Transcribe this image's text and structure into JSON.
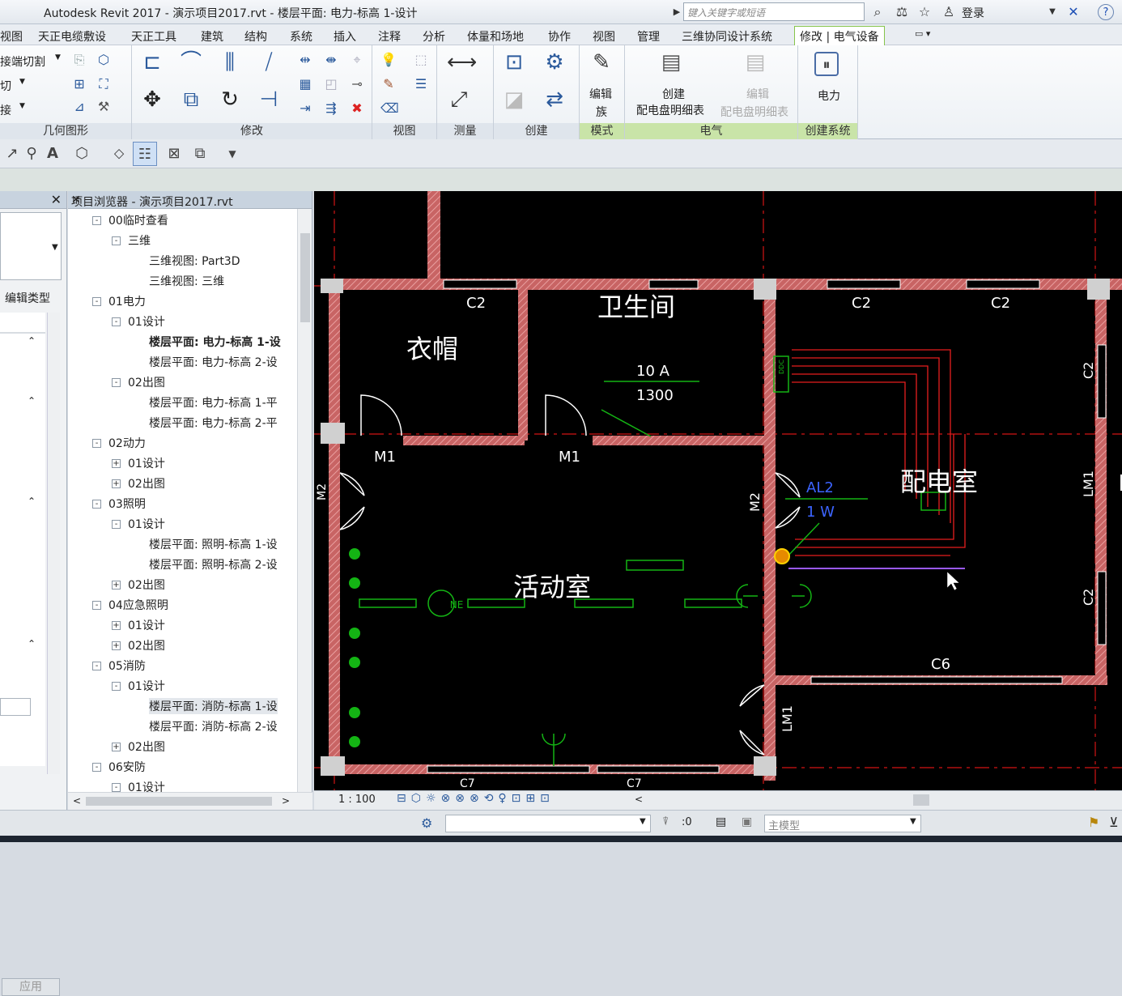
{
  "title": "Autodesk Revit 2017 -      演示项目2017.rvt - 楼层平面: 电力-标高 1-设计",
  "search_placeholder": "键入关键字或短语",
  "login": "登录",
  "menu": [
    "视图",
    "天正电缆敷设",
    "天正工具",
    "建筑",
    "结构",
    "系统",
    "插入",
    "注释",
    "分析",
    "体量和场地",
    "协作",
    "视图",
    "管理",
    "三维协同设计系统",
    "修改 | 电气设备"
  ],
  "ribbon": {
    "geom_items": [
      "接端切割",
      "切",
      "接"
    ],
    "panels": [
      "几何图形",
      "修改",
      "视图",
      "测量",
      "创建",
      "模式",
      "电气",
      "创建系统"
    ],
    "edit_family": [
      "编辑",
      "族"
    ],
    "create_schedule": [
      "创建",
      "配电盘明细表"
    ],
    "edit_schedule": [
      "编辑",
      "配电盘明细表"
    ],
    "power": "电力"
  },
  "props": {
    "edit_type": "编辑类型",
    "apply": "应用"
  },
  "browser": {
    "title": "项目浏览器 - 演示项目2017.rvt",
    "items": [
      {
        "t": "00临时查看",
        "lv": 0,
        "ex": "-"
      },
      {
        "t": "三维",
        "lv": 1,
        "ex": "-"
      },
      {
        "t": "三维视图: Part3D",
        "lv": 2
      },
      {
        "t": "三维视图: 三维",
        "lv": 2
      },
      {
        "t": "01电力",
        "lv": 0,
        "ex": "-"
      },
      {
        "t": "01设计",
        "lv": 1,
        "ex": "-"
      },
      {
        "t": "楼层平面: 电力-标高 1-设",
        "lv": 2,
        "bold": true
      },
      {
        "t": "楼层平面: 电力-标高 2-设",
        "lv": 2
      },
      {
        "t": "02出图",
        "lv": 1,
        "ex": "-"
      },
      {
        "t": "楼层平面: 电力-标高 1-平",
        "lv": 2
      },
      {
        "t": "楼层平面: 电力-标高 2-平",
        "lv": 2
      },
      {
        "t": "02动力",
        "lv": 0,
        "ex": "-"
      },
      {
        "t": "01设计",
        "lv": 1,
        "ex": "+"
      },
      {
        "t": "02出图",
        "lv": 1,
        "ex": "+"
      },
      {
        "t": "03照明",
        "lv": 0,
        "ex": "-"
      },
      {
        "t": "01设计",
        "lv": 1,
        "ex": "-"
      },
      {
        "t": "楼层平面: 照明-标高 1-设",
        "lv": 2
      },
      {
        "t": "楼层平面: 照明-标高 2-设",
        "lv": 2
      },
      {
        "t": "02出图",
        "lv": 1,
        "ex": "+"
      },
      {
        "t": "04应急照明",
        "lv": 0,
        "ex": "-"
      },
      {
        "t": "01设计",
        "lv": 1,
        "ex": "+"
      },
      {
        "t": "02出图",
        "lv": 1,
        "ex": "+"
      },
      {
        "t": "05消防",
        "lv": 0,
        "ex": "-"
      },
      {
        "t": "01设计",
        "lv": 1,
        "ex": "-"
      },
      {
        "t": "楼层平面: 消防-标高 1-设",
        "lv": 2,
        "sel": true
      },
      {
        "t": "楼层平面: 消防-标高 2-设",
        "lv": 2
      },
      {
        "t": "02出图",
        "lv": 1,
        "ex": "+"
      },
      {
        "t": "06安防",
        "lv": 0,
        "ex": "-"
      },
      {
        "t": "01设计",
        "lv": 1,
        "ex": "-"
      }
    ]
  },
  "drawing": {
    "rooms": {
      "r1": "衣帽",
      "r2": "卫生间",
      "r3": "配电室",
      "r4": "活动室"
    },
    "labels": {
      "c2": "C2",
      "c6": "C6",
      "m1": "M1",
      "m2": "M2",
      "lm1": "LM1",
      "ne": "NE",
      "a10": "10 A",
      "n1300": "1300",
      "al2": "AL2",
      "w1": "1 W",
      "box": "DDC",
      "c7": "C7"
    }
  },
  "viewbar": {
    "scale": "1 : 100"
  },
  "status": {
    "zero": ":0",
    "model": "主模型"
  },
  "colors": {
    "wall": "#c86464",
    "grid": "#d21414",
    "green": "#14b414",
    "blue": "#3c64ff",
    "accent": "#86c44b"
  }
}
